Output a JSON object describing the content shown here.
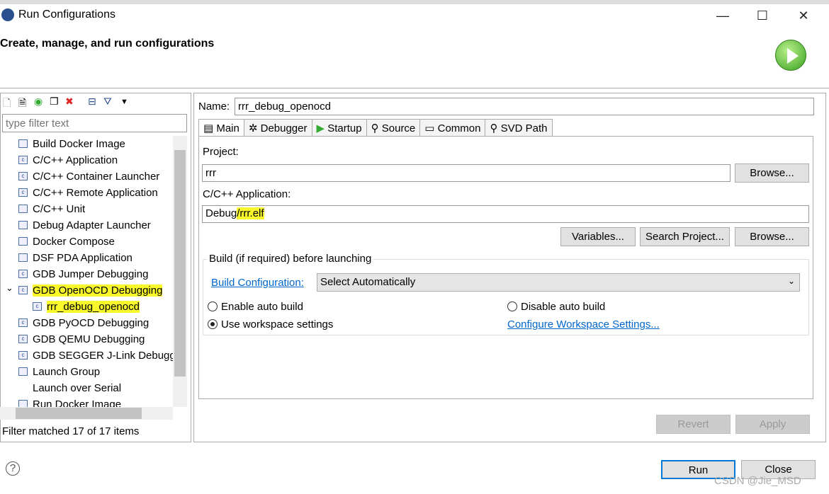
{
  "window": {
    "title": "Run Configurations",
    "minimize": "—",
    "maximize": "☐",
    "close": "✕"
  },
  "header": {
    "text": "Create, manage, and run configurations"
  },
  "left": {
    "filter_placeholder": "type filter text",
    "items": [
      {
        "label": "Build Docker Image",
        "icon": "docker-build-icon"
      },
      {
        "label": "C/C++ Application",
        "icon": "c-icon"
      },
      {
        "label": "C/C++ Container Launcher",
        "icon": "c-icon"
      },
      {
        "label": "C/C++ Remote Application",
        "icon": "c-icon"
      },
      {
        "label": "C/C++ Unit",
        "icon": "cu-icon"
      },
      {
        "label": "Debug Adapter Launcher",
        "icon": "bug-icon"
      },
      {
        "label": "Docker Compose",
        "icon": "play-icon"
      },
      {
        "label": "DSF PDA Application",
        "icon": "bug-icon"
      },
      {
        "label": "GDB Jumper Debugging",
        "icon": "c-icon"
      },
      {
        "label": "GDB OpenOCD Debugging",
        "icon": "c-icon",
        "expanded": true
      },
      {
        "label": "rrr_debug_openocd",
        "icon": "c-icon",
        "child": true,
        "selected": true
      },
      {
        "label": "GDB PyOCD Debugging",
        "icon": "c-icon"
      },
      {
        "label": "GDB QEMU Debugging",
        "icon": "c-icon"
      },
      {
        "label": "GDB SEGGER J-Link Debugging",
        "icon": "c-icon"
      },
      {
        "label": "Launch Group",
        "icon": "launch-group-icon"
      },
      {
        "label": "Launch over Serial",
        "icon": ""
      },
      {
        "label": "Run Docker Image",
        "icon": "docker-run-icon"
      }
    ],
    "status": "Filter matched 17 of 17 items"
  },
  "main": {
    "name_label": "Name:",
    "name_value": "rrr_debug_openocd",
    "tabs": [
      "Main",
      "Debugger",
      "Startup",
      "Source",
      "Common",
      "SVD Path"
    ],
    "project_label": "Project:",
    "project_value": "rrr",
    "browse": "Browse...",
    "app_label": "C/C++ Application:",
    "app_value_a": "Debug",
    "app_value_b": "/rrr.elf",
    "variables": "Variables...",
    "search_project": "Search Project...",
    "build_group": "Build (if required) before launching",
    "build_config_label": "Build Configuration:",
    "build_config_value": "Select Automatically",
    "enable_auto": "Enable auto build",
    "disable_auto": "Disable auto build",
    "use_workspace": "Use workspace settings",
    "configure_ws": "Configure Workspace Settings...",
    "revert": "Revert",
    "apply": "Apply"
  },
  "footer": {
    "run": "Run",
    "close": "Close",
    "help": "?"
  },
  "watermark": "CSDN @Jie_MSD"
}
